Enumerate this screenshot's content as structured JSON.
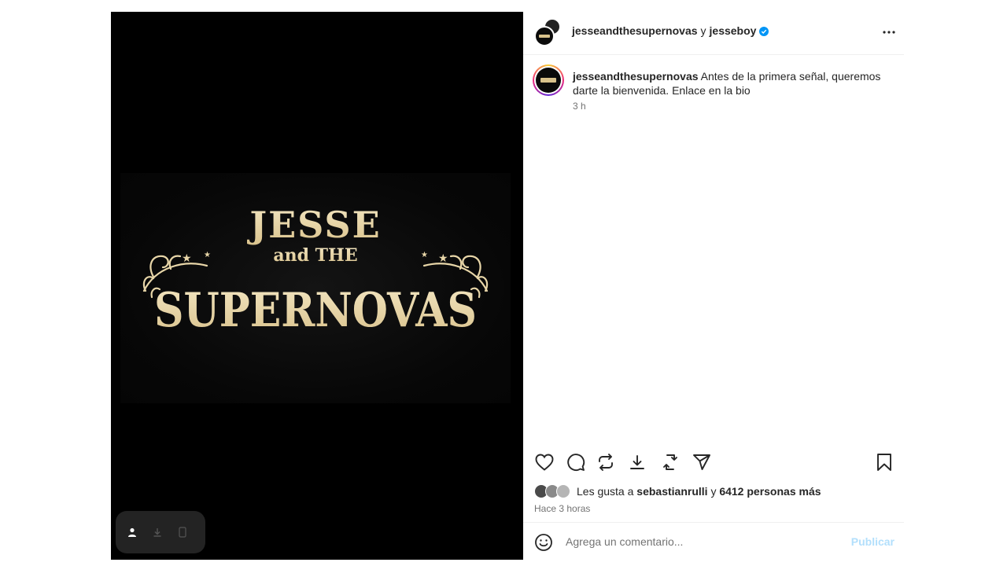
{
  "post": {
    "media": {
      "logo_line1": "JESSE",
      "logo_line2": "and THE",
      "logo_line3": "SUPERNOVAS",
      "logo_color": "#ead9ae"
    },
    "header": {
      "author": "jesseandthesupernovas",
      "conjunction": "y",
      "collaborator": "jesseboy",
      "verified_color": "#0095f6"
    },
    "caption": {
      "username": "jesseandthesupernovas",
      "text": "Antes de la primera señal, queremos darte la bienvenida. Enlace en la bio",
      "time": "3 h"
    },
    "likes": {
      "prefix": "Les gusta a",
      "user": "sebastianrulli",
      "joiner": "y",
      "others": "6412 personas más"
    },
    "posted_ago": "Hace 3 horas",
    "comment": {
      "placeholder": "Agrega un comentario...",
      "publish_label": "Publicar",
      "publish_color": "#b2dffc"
    }
  }
}
